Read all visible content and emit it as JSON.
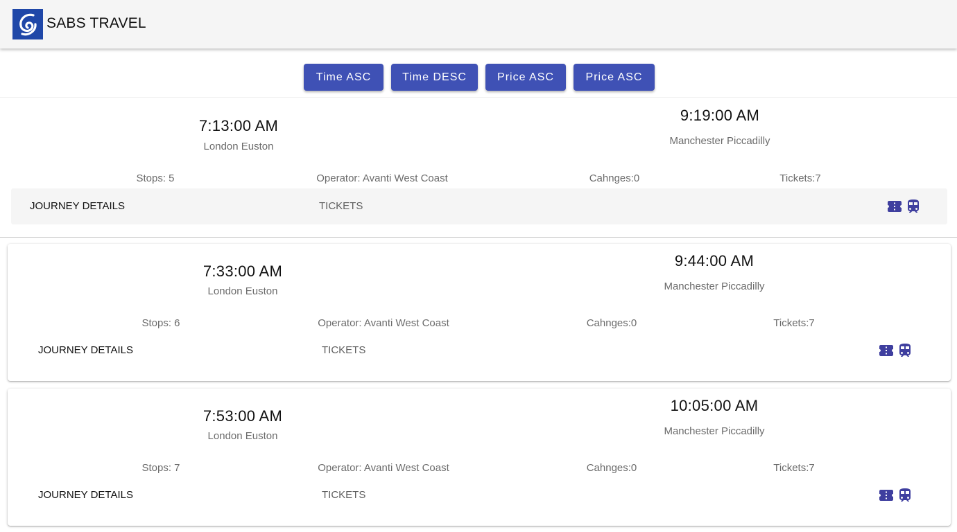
{
  "app": {
    "brand": "SABS TRAVEL",
    "logo_icon": "swirl-logo-icon",
    "accent_color": "#3f51b5",
    "logo_color": "#1f47a8"
  },
  "sort": {
    "buttons": [
      {
        "label": "Time ASC"
      },
      {
        "label": "Time DESC"
      },
      {
        "label": "Price ASC"
      },
      {
        "label": "Price ASC"
      }
    ]
  },
  "journeys": [
    {
      "departure_time": "7:13:00 AM",
      "departure_station": "London Euston",
      "arrival_time": "9:19:00 AM",
      "arrival_station": "Manchester Piccadilly",
      "stops": "Stops: 5",
      "operator": "Operator: Avanti West Coast",
      "changes": "Cahnges:0",
      "tickets": "Tickets:7",
      "journey_details_label": "JOURNEY DETAILS",
      "tickets_label": "TICKETS",
      "icons": [
        "ticket-icon",
        "train-icon"
      ]
    },
    {
      "departure_time": "7:33:00 AM",
      "departure_station": "London Euston",
      "arrival_time": "9:44:00 AM",
      "arrival_station": "Manchester Piccadilly",
      "stops": "Stops: 6",
      "operator": "Operator: Avanti West Coast",
      "changes": "Cahnges:0",
      "tickets": "Tickets:7",
      "journey_details_label": "JOURNEY DETAILS",
      "tickets_label": "TICKETS",
      "icons": [
        "ticket-icon",
        "train-icon"
      ]
    },
    {
      "departure_time": "7:53:00 AM",
      "departure_station": "London Euston",
      "arrival_time": "10:05:00 AM",
      "arrival_station": "Manchester Piccadilly",
      "stops": "Stops: 7",
      "operator": "Operator: Avanti West Coast",
      "changes": "Cahnges:0",
      "tickets": "Tickets:7",
      "journey_details_label": "JOURNEY DETAILS",
      "tickets_label": "TICKETS",
      "icons": [
        "ticket-icon",
        "train-icon"
      ]
    }
  ]
}
